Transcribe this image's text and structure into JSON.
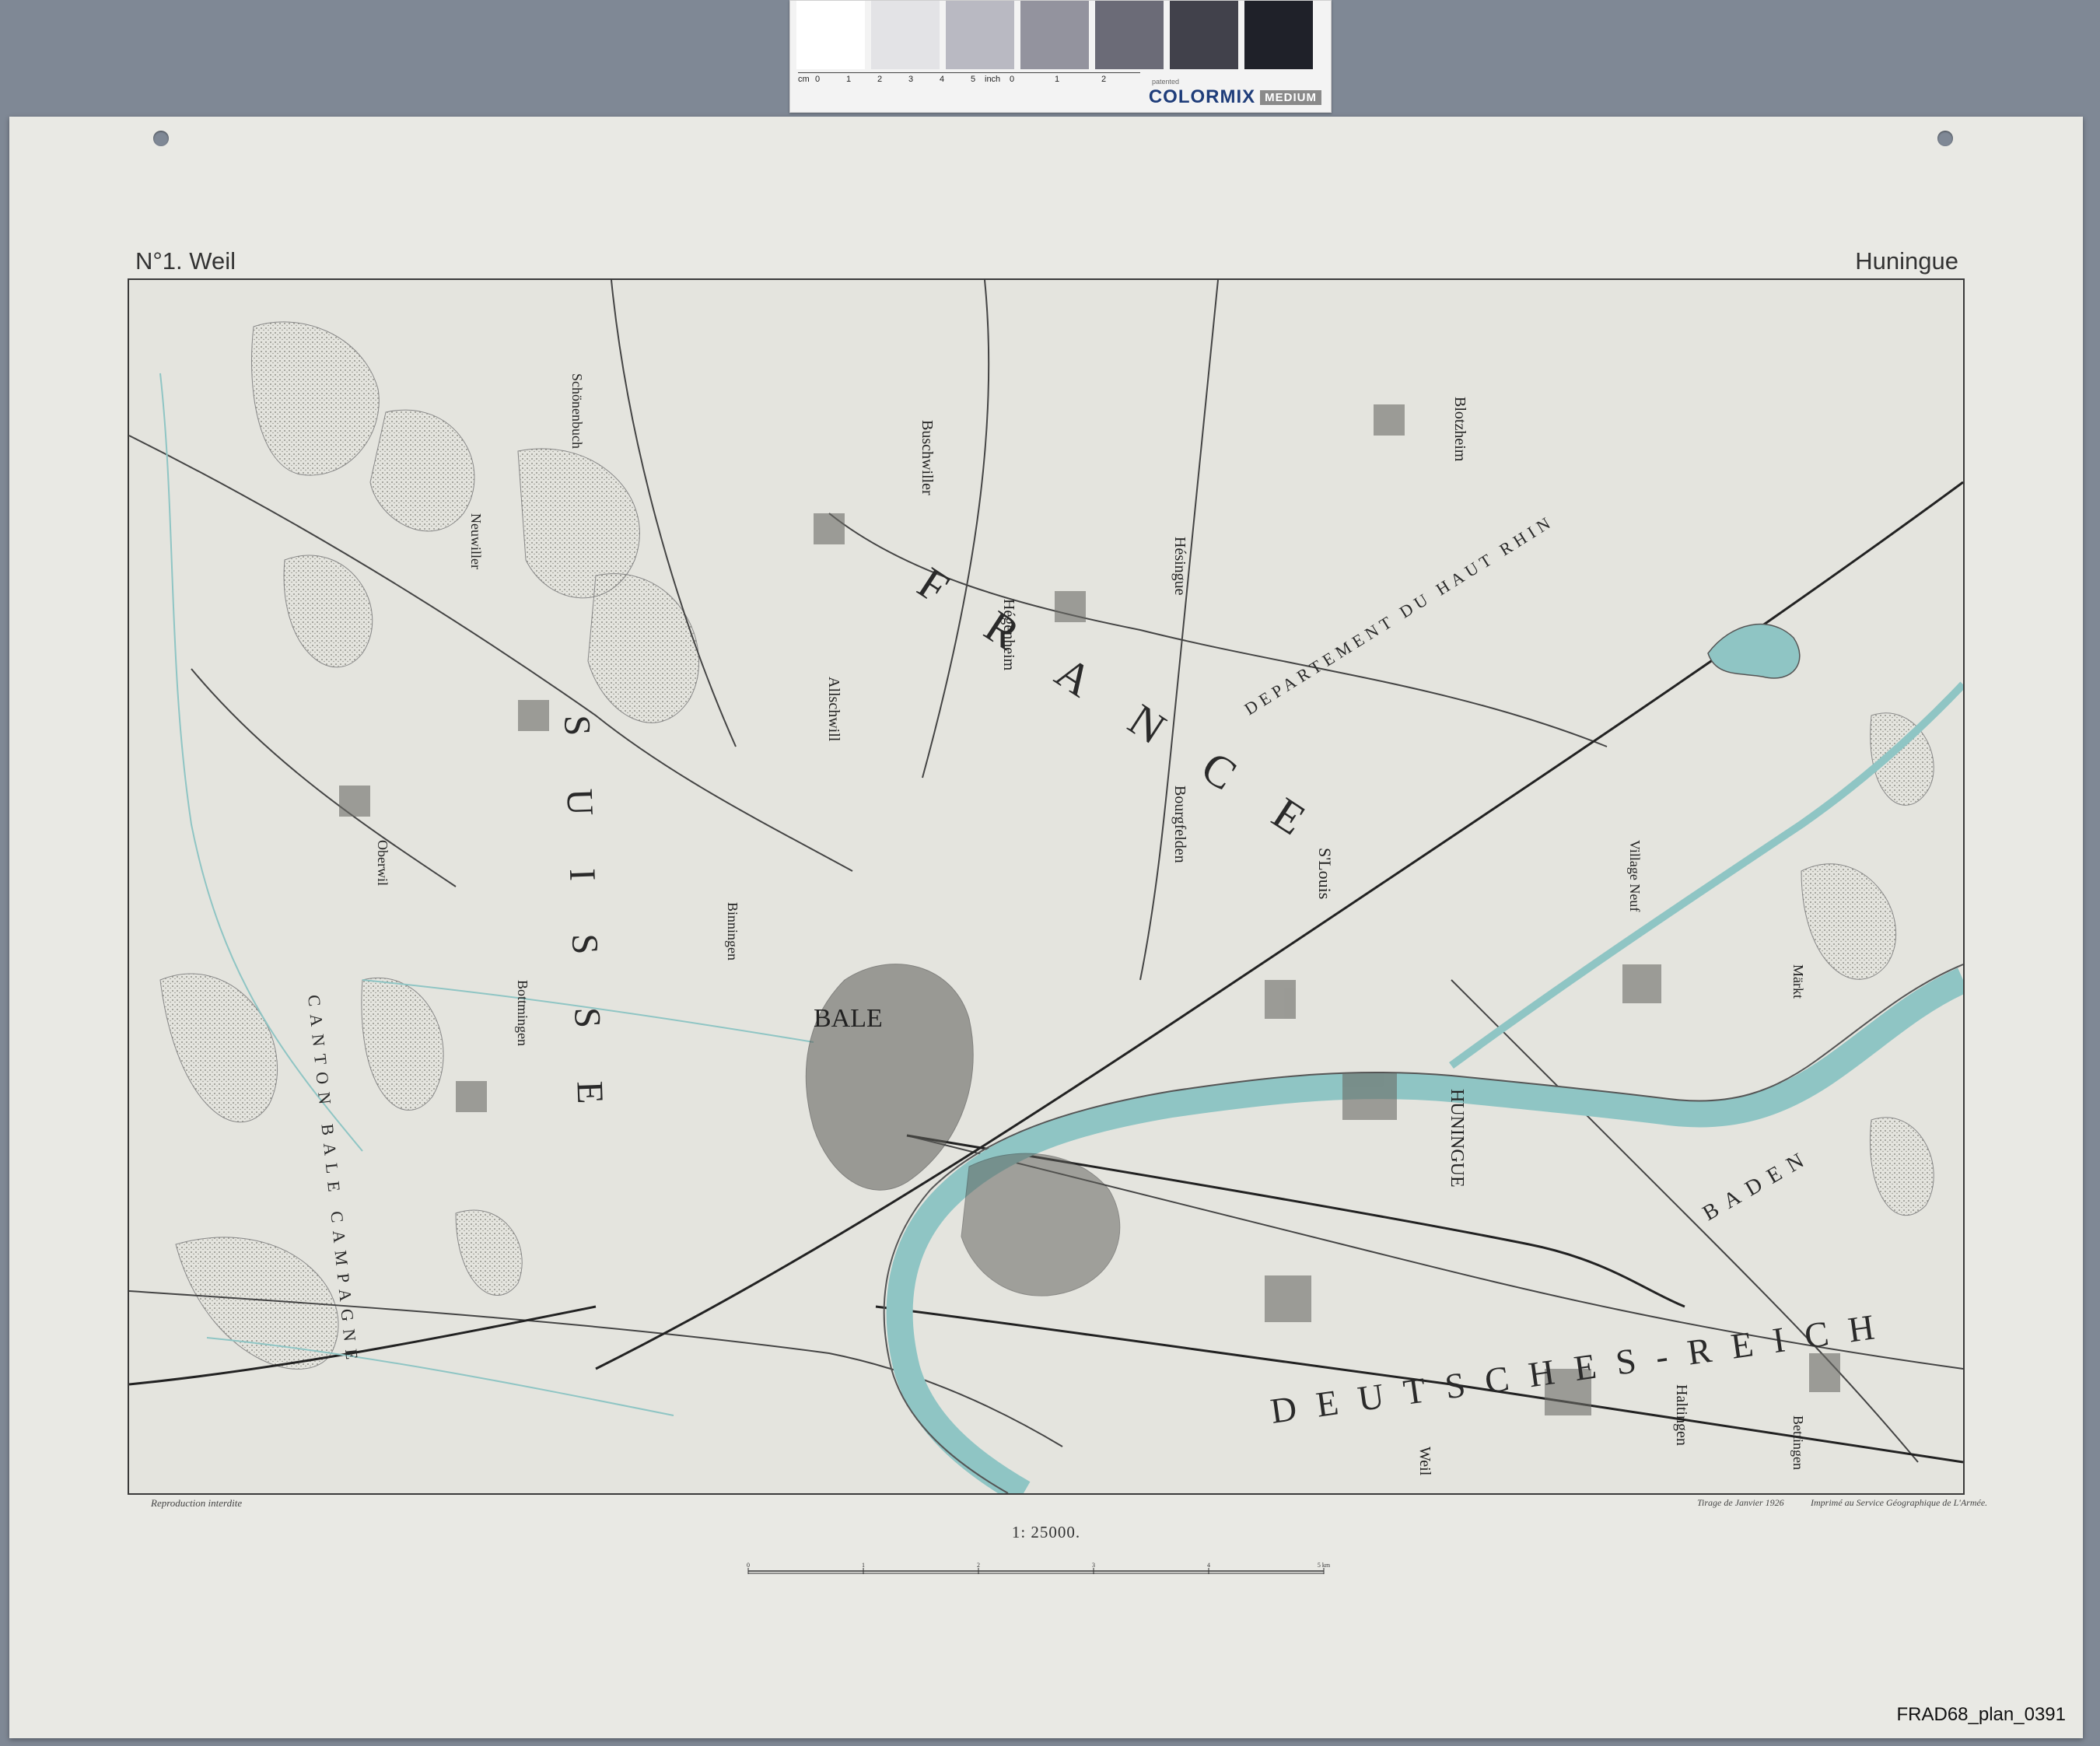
{
  "color_card": {
    "brand": "COLORMIX",
    "badge": "MEDIUM",
    "tiny_text": "patented",
    "ruler_left": [
      "cm",
      "0",
      "1",
      "2",
      "3",
      "4",
      "5"
    ],
    "ruler_right": [
      "inch",
      "0",
      "1",
      "2"
    ],
    "swatch_colors": [
      "#ffffff",
      "#e3e3e6",
      "#b9b9c2",
      "#93939e",
      "#6b6b77",
      "#41414b",
      "#1f2129",
      "#050505"
    ]
  },
  "sheet": {
    "title_left": "N°1. Weil",
    "title_right": "Huningue",
    "footer_left": "Reproduction interdite",
    "footer_mid": "Tirage de Janvier 1926",
    "footer_right": "Imprimé au Service Géographique de L'Armée.",
    "scale": "1: 25000.",
    "scale_ticks": [
      "0",
      "1",
      "2",
      "3",
      "4",
      "5 km"
    ]
  },
  "map": {
    "water_color": "#8fc5c4",
    "country_labels": {
      "france": "FRANCE",
      "suisse": "SUISSE",
      "deutsches_reich": "DEUTSCHES-REICH"
    },
    "region_labels": {
      "departement": "DEPARTEMENT DU HAUT RHIN",
      "canton": "CANTON BALE CAMPAGNE",
      "baden": "BADEN"
    },
    "places": [
      "BALE",
      "HUNINGUE",
      "Hésingue",
      "Blotzheim",
      "Hégenheim",
      "Buschwiller",
      "Allschwill",
      "Bourgfelden",
      "S'Louis",
      "Village Neuf",
      "Binningen",
      "Bottmingen",
      "Oberwil",
      "Neuwiller",
      "Schönenbuch",
      "Weil",
      "Haltingen",
      "Märkt",
      "Bettingen"
    ]
  },
  "archive_id": "FRAD68_plan_0391"
}
